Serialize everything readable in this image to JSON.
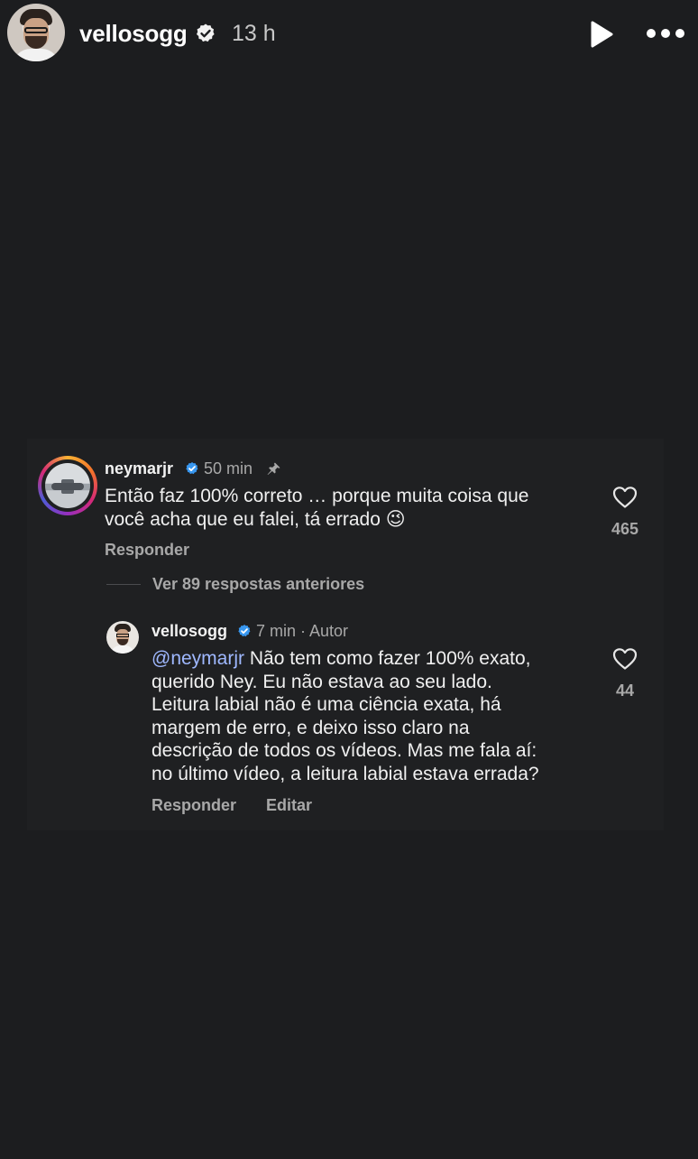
{
  "story": {
    "username": "vellosogg",
    "time": "13 h",
    "icons": {
      "verified": "verified-badge-icon",
      "play": "play-icon",
      "more": "more-options-icon"
    }
  },
  "comment": {
    "username": "neymarjr",
    "time": "50 min",
    "text": "Então faz 100% correto … porque muita coisa que você acha que eu falei, tá errado 😉",
    "line1": "Então faz 100% correto … porque muita coisa que",
    "line2": "você acha que eu falei, tá errado 😉",
    "likes": "465",
    "reply_label": "Responder",
    "icons": {
      "pin": "pin-icon",
      "heart": "heart-icon"
    }
  },
  "replies_toggle": "Ver 89 respostas anteriores",
  "reply": {
    "username": "vellosogg",
    "time": "7 min",
    "separator": " · ",
    "author_badge": "Autor",
    "mention": "@neymarjr",
    "lines": [
      " Não tem como fazer 100% exato,",
      "querido Ney. Eu não estava ao seu lado.",
      "Leitura labial não é uma ciência exata, há",
      "margem de erro, e deixo isso claro na",
      "descrição de todos os vídeos. Mas me fala aí:",
      "no último vídeo, a leitura labial estava errada?"
    ],
    "likes": "44",
    "reply_label": "Responder",
    "edit_label": "Editar"
  },
  "colors": {
    "background": "#1c1d1f",
    "card": "#1f2022",
    "verified": "#3897f0",
    "mention": "#9fb8ff",
    "muted": "#a8a8a8"
  }
}
